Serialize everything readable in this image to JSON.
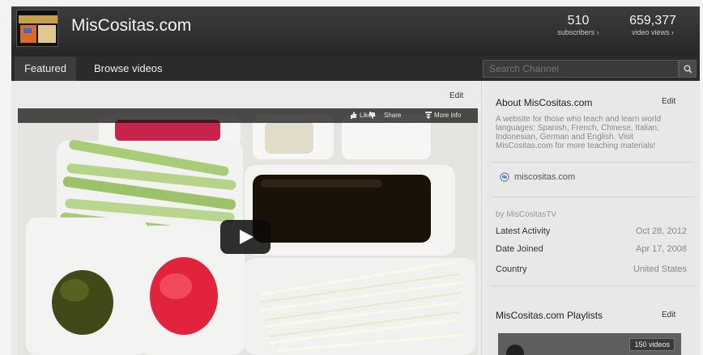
{
  "header": {
    "channel_title": "MisCositas.com",
    "subscribers": {
      "count": "510",
      "label": "subscribers ›"
    },
    "video_views": {
      "count": "659,377",
      "label": "video views ›"
    }
  },
  "nav": {
    "tabs": [
      {
        "label": "Featured",
        "active": true
      },
      {
        "label": "Browse videos",
        "active": false
      }
    ],
    "search_placeholder": "Search Channel"
  },
  "main": {
    "edit_label": "Edit",
    "video_toolbar": {
      "like": "Like",
      "share": "Share",
      "more_info": "More info"
    }
  },
  "sidebar": {
    "about_title": "About MisCositas.com",
    "about_edit": "Edit",
    "about_description": "A website for those who teach and learn world languages: Spanish, French, Chinese, Italian, Indonesian, German and English. Visit MisCositas.com for more teaching materials!",
    "website": "miscositas.com",
    "by_line": "by MisCositasTV",
    "details": [
      {
        "key": "Latest Activity",
        "value": "Oct 28, 2012"
      },
      {
        "key": "Date Joined",
        "value": "Apr 17, 2008"
      },
      {
        "key": "Country",
        "value": "United States"
      }
    ],
    "playlists_title": "MisCositas.com Playlists",
    "playlists_edit": "Edit",
    "playlist_count": "150 videos"
  },
  "colors": {
    "header_bg": "#2f2f2f",
    "nav_bg": "#2b2b2b",
    "sidebar_bg": "#e8e8e8",
    "link_icon": "#6d8fc2"
  },
  "icons": [
    "search-icon",
    "like-icon",
    "dislike-icon",
    "share-icon",
    "more-info-icon",
    "play-icon",
    "globe-icon"
  ]
}
